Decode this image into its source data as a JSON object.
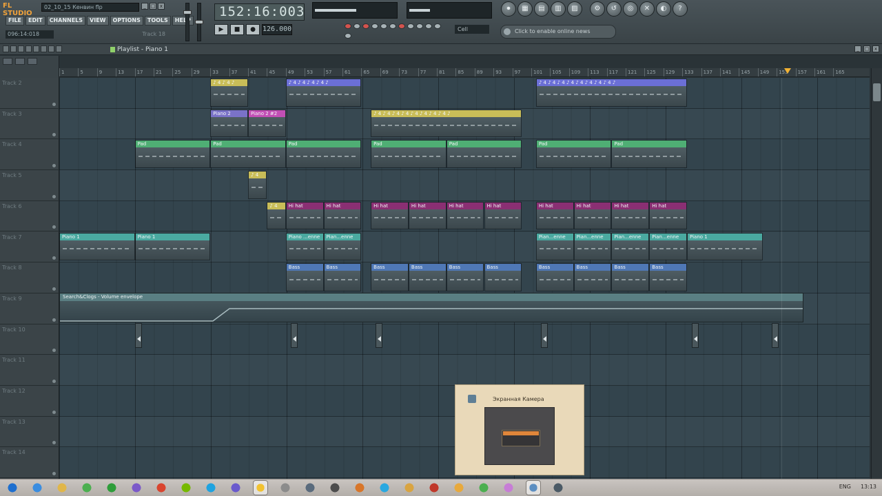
{
  "app": {
    "logo": "FL STUDIO",
    "filename": "02_10_15 Кенвин flp",
    "menu": [
      "FILE",
      "EDIT",
      "CHANNELS",
      "VIEW",
      "OPTIONS",
      "TOOLS",
      "HELP"
    ],
    "position_readout": "096:14:018",
    "hint_text": "Track 18",
    "song_position": "152:16:003",
    "tempo": "126.000",
    "pattern_selector": "Cell",
    "news_text": "Click to enable online news",
    "transport": {
      "play_icon": "▶",
      "stop_icon": "■",
      "record_icon": "●"
    },
    "window_controls": [
      "_",
      "□",
      "x"
    ],
    "round_buttons_left": [
      "⏺",
      "▦",
      "▤",
      "▥",
      "▨"
    ],
    "round_buttons_right": [
      "⚙",
      "↺",
      "◎",
      "✕",
      "◐",
      "?"
    ]
  },
  "playlist": {
    "title": "Playlist - Piano 1",
    "window_controls": [
      "_",
      "□",
      "x"
    ]
  },
  "ruler": {
    "ticks": [
      "1",
      "5",
      "9",
      "13",
      "17",
      "21",
      "25",
      "29",
      "33",
      "37",
      "41",
      "45",
      "49",
      "53",
      "57",
      "61",
      "65",
      "69",
      "73",
      "77",
      "81",
      "85",
      "89",
      "93",
      "97",
      "101",
      "105",
      "109",
      "113",
      "117",
      "121",
      "125",
      "129",
      "133",
      "137",
      "141",
      "145",
      "149",
      "153",
      "157",
      "161",
      "165"
    ]
  },
  "tracks": [
    {
      "name": "Track 2"
    },
    {
      "name": "Track 3"
    },
    {
      "name": "Track 4"
    },
    {
      "name": "Track 5"
    },
    {
      "name": "Track 6"
    },
    {
      "name": "Track 7"
    },
    {
      "name": "Track 8"
    },
    {
      "name": "Track 9"
    },
    {
      "name": "Track 10"
    },
    {
      "name": "Track 11"
    },
    {
      "name": "Track 12"
    },
    {
      "name": "Track 13"
    },
    {
      "name": "Track 14"
    }
  ],
  "clips": [
    {
      "track": 0,
      "start": 33,
      "end": 41,
      "label": "♪ 4 ♪ 4 ♪",
      "color": "#c9bd58"
    },
    {
      "track": 0,
      "start": 49,
      "end": 65,
      "label": "♪ 4 ♪ 4 ♪ 4 ♪ 4 ♪",
      "color": "#6b6fd6"
    },
    {
      "track": 0,
      "start": 102,
      "end": 134,
      "label": "♪ 4 ♪ 4 ♪ 4 ♪ 4 ♪ 4 ♪ 4 ♪ 4 ♪ 4 ♪",
      "color": "#6b6fd6"
    },
    {
      "track": 1,
      "start": 33,
      "end": 41,
      "label": "Piano 2",
      "color": "#7a72c8"
    },
    {
      "track": 1,
      "start": 41,
      "end": 49,
      "label": "Piano 2 #2",
      "color": "#c24fb5"
    },
    {
      "track": 1,
      "start": 67,
      "end": 99,
      "label": "♪ 4 ♪ 4 ♪ 4 ♪ 4 ♪ 4 ♪ 4 ♪ 4 ♪ 4 ♪",
      "color": "#c9bd58"
    },
    {
      "track": 2,
      "start": 17,
      "end": 33,
      "label": "Pad",
      "color": "#4fae74"
    },
    {
      "track": 2,
      "start": 33,
      "end": 49,
      "label": "Pad",
      "color": "#4fae74"
    },
    {
      "track": 2,
      "start": 49,
      "end": 65,
      "label": "Pad",
      "color": "#4fae74"
    },
    {
      "track": 2,
      "start": 67,
      "end": 83,
      "label": "Pad",
      "color": "#4fae74"
    },
    {
      "track": 2,
      "start": 83,
      "end": 99,
      "label": "Pad",
      "color": "#4fae74"
    },
    {
      "track": 2,
      "start": 102,
      "end": 118,
      "label": "Pad",
      "color": "#4fae74"
    },
    {
      "track": 2,
      "start": 118,
      "end": 134,
      "label": "Pad",
      "color": "#4fae74"
    },
    {
      "track": 3,
      "start": 41,
      "end": 45,
      "label": "♪ 4",
      "color": "#c9bd58"
    },
    {
      "track": 4,
      "start": 45,
      "end": 49,
      "label": "♪ 4",
      "color": "#c9bd58"
    },
    {
      "track": 4,
      "start": 49,
      "end": 57,
      "label": "Hi hat",
      "color": "#8a2f73"
    },
    {
      "track": 4,
      "start": 57,
      "end": 65,
      "label": "Hi hat",
      "color": "#8a2f73"
    },
    {
      "track": 4,
      "start": 67,
      "end": 75,
      "label": "Hi hat",
      "color": "#8a2f73"
    },
    {
      "track": 4,
      "start": 75,
      "end": 83,
      "label": "Hi hat",
      "color": "#8a2f73"
    },
    {
      "track": 4,
      "start": 83,
      "end": 91,
      "label": "Hi hat",
      "color": "#8a2f73"
    },
    {
      "track": 4,
      "start": 91,
      "end": 99,
      "label": "Hi hat",
      "color": "#8a2f73"
    },
    {
      "track": 4,
      "start": 102,
      "end": 110,
      "label": "Hi hat",
      "color": "#8a2f73"
    },
    {
      "track": 4,
      "start": 110,
      "end": 118,
      "label": "Hi hat",
      "color": "#8a2f73"
    },
    {
      "track": 4,
      "start": 118,
      "end": 126,
      "label": "Hi hat",
      "color": "#8a2f73"
    },
    {
      "track": 4,
      "start": 126,
      "end": 134,
      "label": "Hi hat",
      "color": "#8a2f73"
    },
    {
      "track": 5,
      "start": 1,
      "end": 17,
      "label": "Piano 1",
      "color": "#4aa9a0"
    },
    {
      "track": 5,
      "start": 17,
      "end": 33,
      "label": "Piano 1",
      "color": "#4aa9a0"
    },
    {
      "track": 5,
      "start": 49,
      "end": 57,
      "label": "Piano ...enne",
      "color": "#4aa9a0"
    },
    {
      "track": 5,
      "start": 57,
      "end": 65,
      "label": "Pian...enne",
      "color": "#4aa9a0"
    },
    {
      "track": 5,
      "start": 102,
      "end": 110,
      "label": "Pian...enne",
      "color": "#4aa9a0"
    },
    {
      "track": 5,
      "start": 110,
      "end": 118,
      "label": "Pian...enne",
      "color": "#4aa9a0"
    },
    {
      "track": 5,
      "start": 118,
      "end": 126,
      "label": "Pian...enne",
      "color": "#4aa9a0"
    },
    {
      "track": 5,
      "start": 126,
      "end": 134,
      "label": "Pian...enne",
      "color": "#4aa9a0"
    },
    {
      "track": 5,
      "start": 134,
      "end": 150,
      "label": "Piano 1",
      "color": "#4aa9a0"
    },
    {
      "track": 6,
      "start": 49,
      "end": 57,
      "label": "Bass",
      "color": "#4f78b6"
    },
    {
      "track": 6,
      "start": 57,
      "end": 65,
      "label": "Bass",
      "color": "#4f78b6"
    },
    {
      "track": 6,
      "start": 67,
      "end": 75,
      "label": "Bass",
      "color": "#4f78b6"
    },
    {
      "track": 6,
      "start": 75,
      "end": 83,
      "label": "Bass",
      "color": "#4f78b6"
    },
    {
      "track": 6,
      "start": 83,
      "end": 91,
      "label": "Bass",
      "color": "#4f78b6"
    },
    {
      "track": 6,
      "start": 91,
      "end": 99,
      "label": "Bass",
      "color": "#4f78b6"
    },
    {
      "track": 6,
      "start": 102,
      "end": 110,
      "label": "Bass",
      "color": "#4f78b6"
    },
    {
      "track": 6,
      "start": 110,
      "end": 118,
      "label": "Bass",
      "color": "#4f78b6"
    },
    {
      "track": 6,
      "start": 118,
      "end": 126,
      "label": "Bass",
      "color": "#4f78b6"
    },
    {
      "track": 6,
      "start": 126,
      "end": 134,
      "label": "Bass",
      "color": "#4f78b6"
    }
  ],
  "automation": {
    "label": "Search&Clogs - Volume envelope",
    "color": "#5a7f83"
  },
  "markers_bars": [
    17,
    50,
    68,
    103,
    135,
    152
  ],
  "popup": {
    "title": "Экранная Камера"
  },
  "taskbar": {
    "icons": [
      "start-icon",
      "ie-icon",
      "explorer-icon",
      "chrome-icon",
      "utorrent-icon",
      "viber-icon",
      "media-icon",
      "android-icon",
      "skype-icon",
      "app-d-icon",
      "fl-studio-icon",
      "tool-icon",
      "printer-icon",
      "game-icon",
      "tool2-icon",
      "skype2-icon",
      "settings-icon",
      "tool3-icon",
      "folder-icon",
      "chrome2-icon",
      "camera-icon",
      "desktop-icon",
      "monitor-icon"
    ],
    "active_indices": [
      10,
      21
    ],
    "lang": "ENG",
    "clock": "13:13"
  }
}
